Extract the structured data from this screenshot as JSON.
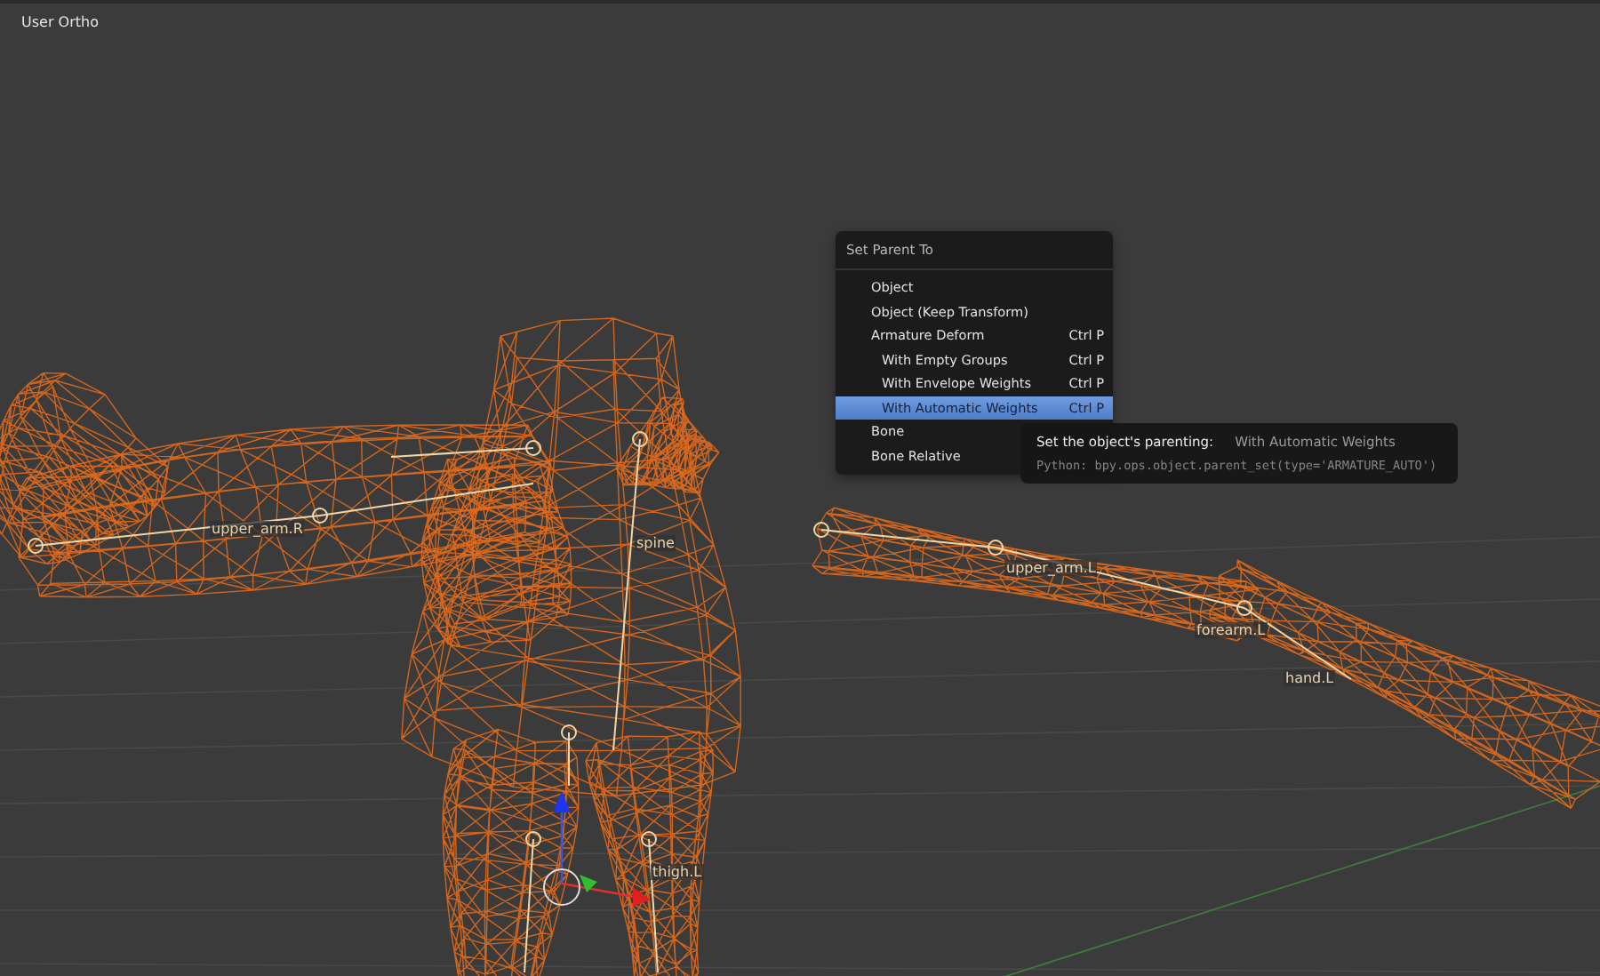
{
  "viewport": {
    "view_label": "User Ortho",
    "bone_labels": [
      {
        "text": "upper_arm.R"
      },
      {
        "text": "spine"
      },
      {
        "text": "upper_arm.L"
      },
      {
        "text": "forearm.L"
      },
      {
        "text": "hand.L"
      },
      {
        "text": "thigh.L"
      }
    ]
  },
  "menu": {
    "title": "Set Parent To",
    "items": [
      {
        "label": "Object",
        "selected": false
      },
      {
        "label": "Object (Keep Transform)",
        "selected": false
      },
      {
        "label": "Armature Deform",
        "shortcut": "Ctrl P",
        "selected": false,
        "children": [
          {
            "label": "With Empty Groups",
            "shortcut": "Ctrl P",
            "selected": false
          },
          {
            "label": "With Envelope Weights",
            "shortcut": "Ctrl P",
            "selected": false
          },
          {
            "label": "With Automatic Weights",
            "shortcut": "Ctrl P",
            "selected": true
          }
        ]
      },
      {
        "label": "Bone",
        "selected": false
      },
      {
        "label": "Bone Relative",
        "selected": false
      }
    ]
  },
  "tooltip": {
    "description": "Set the object's parenting:",
    "value": "With Automatic Weights",
    "python": "Python: bpy.ops.object.parent_set(type='ARMATURE_AUTO')"
  }
}
